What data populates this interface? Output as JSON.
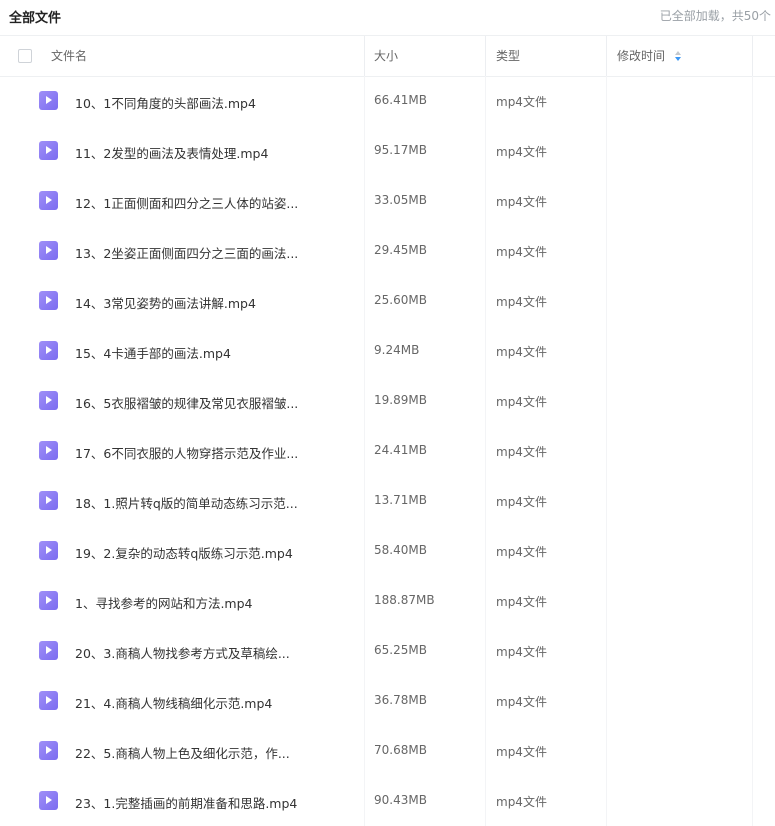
{
  "page": {
    "title": "全部文件",
    "load_status": "已全部加载，共50个"
  },
  "table": {
    "columns": {
      "name": "文件名",
      "size": "大小",
      "type": "类型",
      "modified": "修改时间"
    },
    "sort": {
      "column": "modified",
      "direction": "descending"
    },
    "rows": [
      {
        "name": "10、1不同角度的头部画法.mp4",
        "size": "66.41MB",
        "type": "mp4文件"
      },
      {
        "name": "11、2发型的画法及表情处理.mp4",
        "size": "95.17MB",
        "type": "mp4文件"
      },
      {
        "name": "12、1正面侧面和四分之三人体的站姿...",
        "size": "33.05MB",
        "type": "mp4文件"
      },
      {
        "name": "13、2坐姿正面侧面四分之三面的画法...",
        "size": "29.45MB",
        "type": "mp4文件"
      },
      {
        "name": "14、3常见姿势的画法讲解.mp4",
        "size": "25.60MB",
        "type": "mp4文件"
      },
      {
        "name": "15、4卡通手部的画法.mp4",
        "size": "9.24MB",
        "type": "mp4文件"
      },
      {
        "name": "16、5衣服褶皱的规律及常见衣服褶皱...",
        "size": "19.89MB",
        "type": "mp4文件"
      },
      {
        "name": "17、6不同衣服的人物穿搭示范及作业...",
        "size": "24.41MB",
        "type": "mp4文件"
      },
      {
        "name": "18、1.照片转q版的简单动态练习示范...",
        "size": "13.71MB",
        "type": "mp4文件"
      },
      {
        "name": "19、2.复杂的动态转q版练习示范.mp4",
        "size": "58.40MB",
        "type": "mp4文件"
      },
      {
        "name": "1、寻找参考的网站和方法.mp4",
        "size": "188.87MB",
        "type": "mp4文件"
      },
      {
        "name": "20、3.商稿人物找参考方式及草稿绘...",
        "size": "65.25MB",
        "type": "mp4文件"
      },
      {
        "name": "21、4.商稿人物线稿细化示范.mp4",
        "size": "36.78MB",
        "type": "mp4文件"
      },
      {
        "name": "22、5.商稿人物上色及细化示范，作...",
        "size": "70.68MB",
        "type": "mp4文件"
      },
      {
        "name": "23、1.完整插画的前期准备和思路.mp4",
        "size": "90.43MB",
        "type": "mp4文件"
      }
    ]
  },
  "icons": {
    "file_icon": "video-file-icon",
    "file_icon_color": "#8b7cf4",
    "sort_active_color": "#3b97f5"
  }
}
